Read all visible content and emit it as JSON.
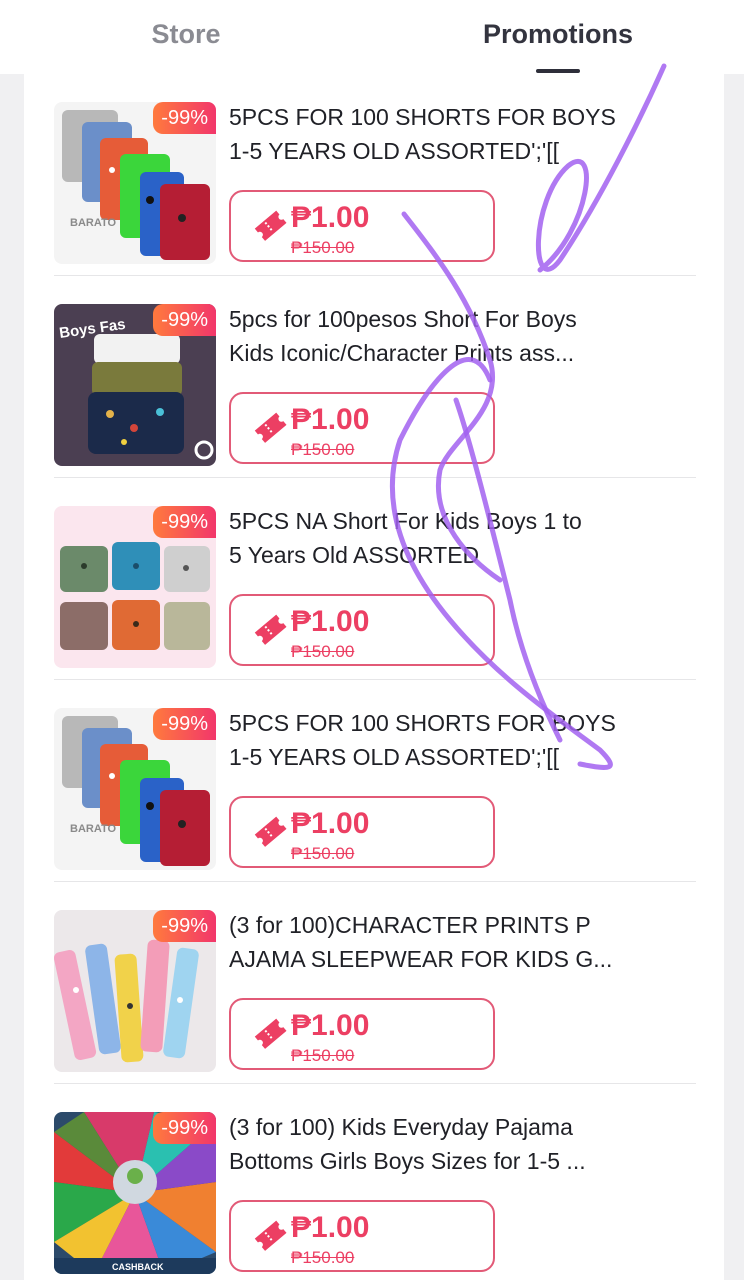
{
  "tabs": {
    "store": "Store",
    "promotions": "Promotions"
  },
  "products": [
    {
      "title": "5PCS FOR 100 SHORTS FOR BOYS\n1-5 YEARS OLD ASSORTED';'[[",
      "discount": "-99%",
      "price": "₱1.00",
      "old_price": "₱150.00",
      "thumb_text": "BARATO"
    },
    {
      "title": "5pcs for 100pesos Short For Boys\nKids Iconic/Character Prints ass...",
      "discount": "-99%",
      "price": "₱1.00",
      "old_price": "₱150.00",
      "thumb_text": "Boys Fas"
    },
    {
      "title": "5PCS NA Short For Kids Boys 1 to\n5 Years Old ASSORTED",
      "discount": "-99%",
      "price": "₱1.00",
      "old_price": "₱150.00",
      "thumb_text": ""
    },
    {
      "title": "5PCS FOR 100 SHORTS FOR BOYS\n1-5 YEARS OLD ASSORTED';'[[",
      "discount": "-99%",
      "price": "₱1.00",
      "old_price": "₱150.00",
      "thumb_text": "BARATO"
    },
    {
      "title": "(3 for 100)CHARACTER PRINTS P\nAJAMA SLEEPWEAR FOR KIDS G...",
      "discount": "-99%",
      "price": "₱1.00",
      "old_price": "₱150.00",
      "thumb_text": ""
    },
    {
      "title": "(3 for 100) Kids Everyday Pajama\nBottoms Girls Boys Sizes for 1-5 ...",
      "discount": "-99%",
      "price": "₱1.00",
      "old_price": "₱150.00",
      "thumb_text": "CASHBACK"
    }
  ],
  "colors": {
    "accent": "#ec3f63",
    "badge_start": "#ff7a3d",
    "badge_end": "#f2366b",
    "scribble": "#a262f0"
  },
  "icons": {
    "voucher": "ticket-icon"
  }
}
